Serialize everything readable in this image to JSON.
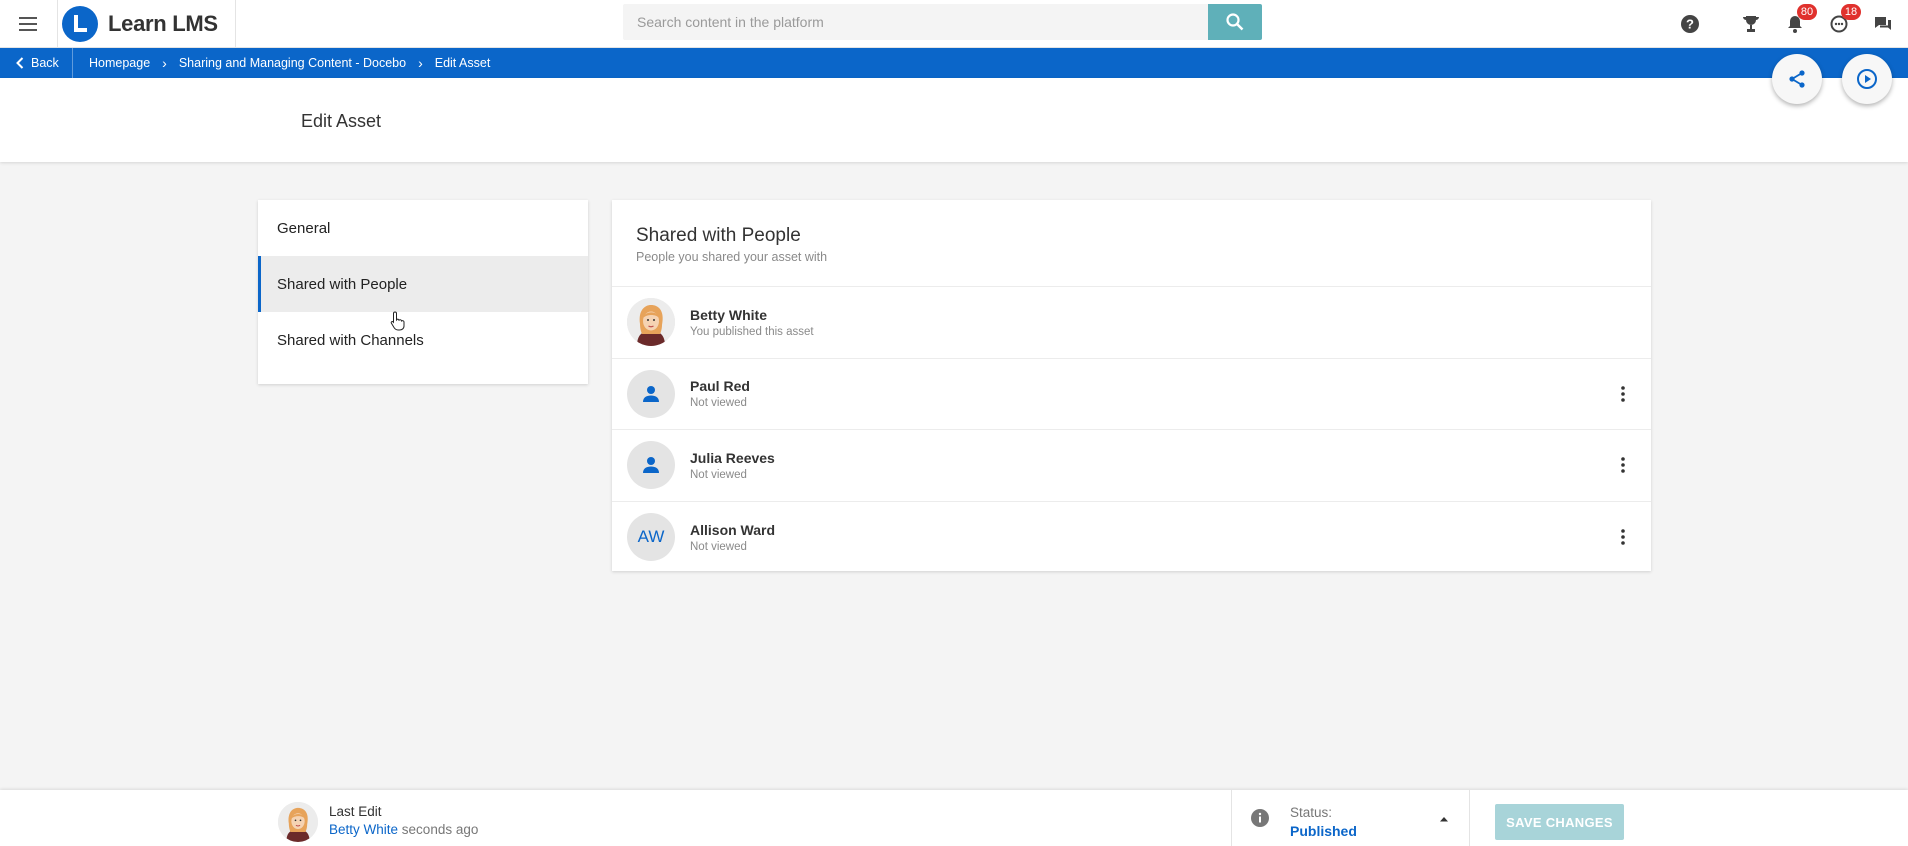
{
  "header": {
    "app_name": "Learn LMS",
    "search_placeholder": "Search content in the platform",
    "notification_count": "80",
    "message_count": "18",
    "icons": [
      "menu-icon",
      "search-icon",
      "help-icon",
      "trophy-icon",
      "bell-icon",
      "chat-bubble-icon",
      "forum-icon"
    ]
  },
  "breadcrumb": {
    "back_label": "Back",
    "items": [
      "Homepage",
      "Sharing and Managing Content - Docebo",
      "Edit Asset"
    ]
  },
  "page": {
    "title": "Edit Asset"
  },
  "menu": {
    "items": [
      {
        "label": "General",
        "active": false
      },
      {
        "label": "Shared with People",
        "active": true
      },
      {
        "label": "Shared with Channels",
        "active": false
      }
    ]
  },
  "panel": {
    "title": "Shared with People",
    "subtitle": "People you shared your asset with",
    "people": [
      {
        "name": "Betty White",
        "status": "You published this asset",
        "avatar": "photo"
      },
      {
        "name": "Paul Red",
        "status": "Not viewed",
        "avatar": "person-icon"
      },
      {
        "name": "Julia Reeves",
        "status": "Not viewed",
        "avatar": "person-icon"
      },
      {
        "name": "Allison Ward",
        "status": "Not viewed",
        "avatar": "initials",
        "initials": "AW"
      }
    ]
  },
  "footer": {
    "last_edit_label": "Last Edit",
    "last_edit_user": "Betty White",
    "last_edit_time": "seconds ago",
    "status_label": "Status:",
    "status_value": "Published",
    "save_label": "SAVE CHANGES"
  },
  "colors": {
    "brand_blue": "#0b66c9",
    "search_button": "#5fb0b9",
    "save_disabled": "#a8d4d9",
    "badge_red": "#e0312d"
  }
}
